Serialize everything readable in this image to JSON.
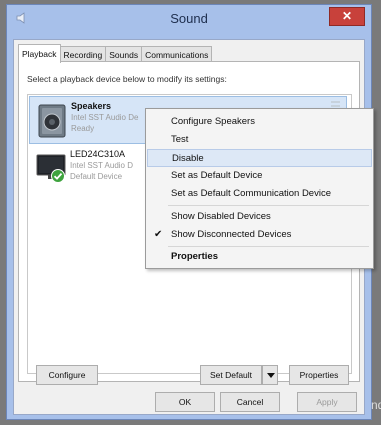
{
  "window": {
    "title": "Sound",
    "close_label": "✕",
    "colors": {
      "frame": "#a7c0ea",
      "close": "#c8413b",
      "selection": "#d6e5f7"
    }
  },
  "tabs": [
    {
      "label": "Playback",
      "active": true
    },
    {
      "label": "Recording",
      "active": false
    },
    {
      "label": "Sounds",
      "active": false
    },
    {
      "label": "Communications",
      "active": false
    }
  ],
  "instruction": "Select a playback device below to modify its settings:",
  "devices": [
    {
      "name": "Speakers",
      "description": "Intel SST Audio De",
      "status": "Ready",
      "icon": "speaker-icon",
      "selected": true
    },
    {
      "name": "LED24C310A",
      "description": "Intel SST Audio D",
      "status": "Default Device",
      "icon": "monitor-icon",
      "default": true
    }
  ],
  "context_menu": {
    "items": [
      {
        "label": "Configure Speakers"
      },
      {
        "label": "Test"
      },
      {
        "label": "Disable",
        "highlighted": true
      },
      {
        "label": "Set as Default Device"
      },
      {
        "label": "Set as Default Communication Device"
      },
      {
        "label": "Show Disabled Devices"
      },
      {
        "label": "Show Disconnected Devices",
        "checked": true
      },
      {
        "label": "Properties",
        "bold": true
      }
    ],
    "check_mark": "✔"
  },
  "buttons": {
    "configure": "Configure",
    "set_default": "Set Default",
    "properties": "Properties",
    "ok": "OK",
    "cancel": "Cancel",
    "apply": "Apply"
  },
  "side_text": "nd"
}
